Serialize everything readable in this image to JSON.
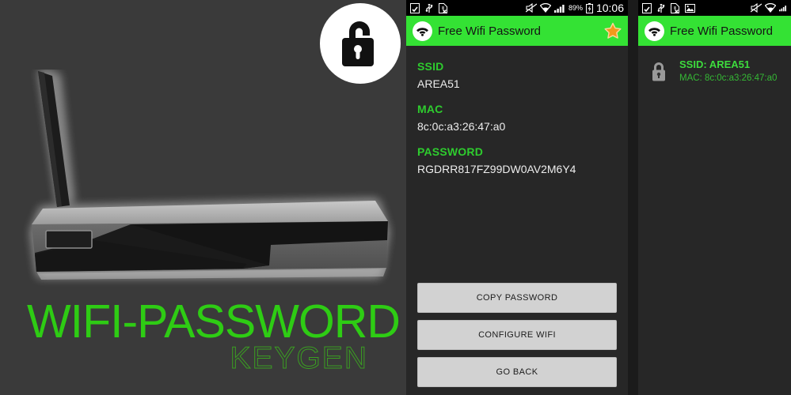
{
  "promo": {
    "title": "WIFI-PASSWORD",
    "subtitle": "KEYGEN",
    "lock_badge_icon": "unlocked-padlock-icon",
    "router_icon": "wifi-router-illustration",
    "accent_color": "#2ecc14",
    "background_color": "#3a3a3a"
  },
  "phone_main": {
    "statusbar": {
      "icons": [
        "sd-card-icon",
        "usb-icon",
        "document-error-icon",
        "mute-icon",
        "wifi-icon",
        "signal-bars-icon"
      ],
      "battery_percent": "89%",
      "battery_icon": "battery-charging-icon",
      "clock": "10:06"
    },
    "actionbar": {
      "logo_icon": "wifi-logo-icon",
      "title": "Free Wifi Password",
      "star_icon": "star-icon",
      "background_color": "#34e234"
    },
    "fields": [
      {
        "label": "SSID",
        "value": "AREA51"
      },
      {
        "label": "MAC",
        "value": "8c:0c:a3:26:47:a0"
      },
      {
        "label": "PASSWORD",
        "value": "RGDRR817FZ99DW0AV2M6Y4"
      }
    ],
    "buttons": [
      {
        "label": "COPY PASSWORD"
      },
      {
        "label": "CONFIGURE WIFI"
      },
      {
        "label": "GO BACK"
      }
    ]
  },
  "phone_right": {
    "statusbar": {
      "icons": [
        "sd-card-icon",
        "usb-icon",
        "document-error-icon",
        "gallery-icon",
        "mute-icon",
        "wifi-icon",
        "signal-bars-icon"
      ]
    },
    "actionbar": {
      "logo_icon": "wifi-logo-icon",
      "title": "Free Wifi Password",
      "background_color": "#34e234"
    },
    "list_items": [
      {
        "lock_icon": "locked-padlock-icon",
        "ssid": "SSID: AREA51",
        "mac": "MAC: 8c:0c:a3:26:47:a0"
      }
    ]
  }
}
